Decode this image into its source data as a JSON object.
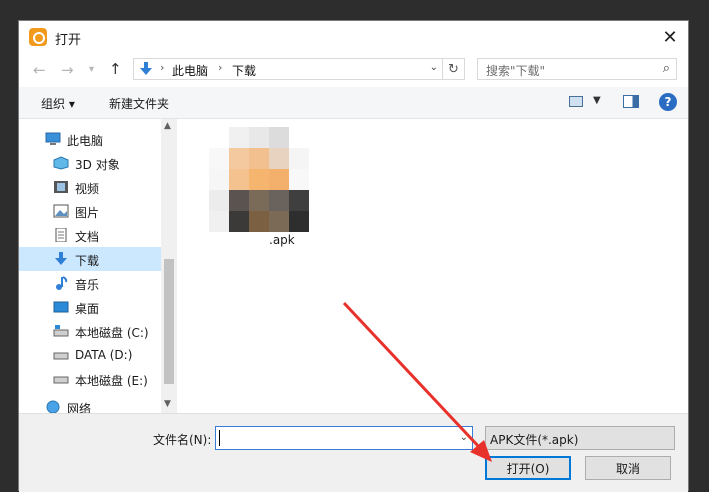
{
  "window": {
    "title": "打开",
    "close_label": "✕"
  },
  "nav": {
    "back_label": "←",
    "forward_label": "→",
    "history_label": "▾",
    "up_label": "↑",
    "path": [
      "此电脑",
      "下载"
    ],
    "separator": "›",
    "dropdown_label": "⌄",
    "refresh_label": "↻",
    "search_placeholder": "搜索\"下载\"",
    "search_icon": "⌕"
  },
  "toolbar": {
    "organize_label": "组织 ▾",
    "new_folder_label": "新建文件夹",
    "view_dd": "▼",
    "help_label": "?"
  },
  "sidebar": {
    "items": [
      {
        "label": "此电脑",
        "icon": "computer-icon"
      },
      {
        "label": "3D 对象",
        "icon": "cube-icon"
      },
      {
        "label": "视频",
        "icon": "video-icon"
      },
      {
        "label": "图片",
        "icon": "picture-icon"
      },
      {
        "label": "文档",
        "icon": "document-icon"
      },
      {
        "label": "下载",
        "icon": "download-icon",
        "selected": true
      },
      {
        "label": "音乐",
        "icon": "music-icon"
      },
      {
        "label": "桌面",
        "icon": "desktop-icon"
      },
      {
        "label": "本地磁盘 (C:)",
        "icon": "drive-icon"
      },
      {
        "label": "DATA (D:)",
        "icon": "drive-icon"
      },
      {
        "label": "本地磁盘 (E:)",
        "icon": "drive-icon"
      },
      {
        "label": "网络",
        "icon": "network-icon"
      }
    ],
    "scroll_up": "▲",
    "scroll_down": "▼"
  },
  "files": [
    {
      "name": ".apk"
    }
  ],
  "bottom": {
    "filename_label": "文件名(N):",
    "filename_value": "",
    "filename_dd": "⌄",
    "filetype_label": "APK文件(*.apk)",
    "open_label": "打开(O)",
    "cancel_label": "取消"
  },
  "colors": {
    "accent": "#0078d7",
    "selection": "#cce8ff",
    "annotation_arrow": "#e8312a"
  }
}
